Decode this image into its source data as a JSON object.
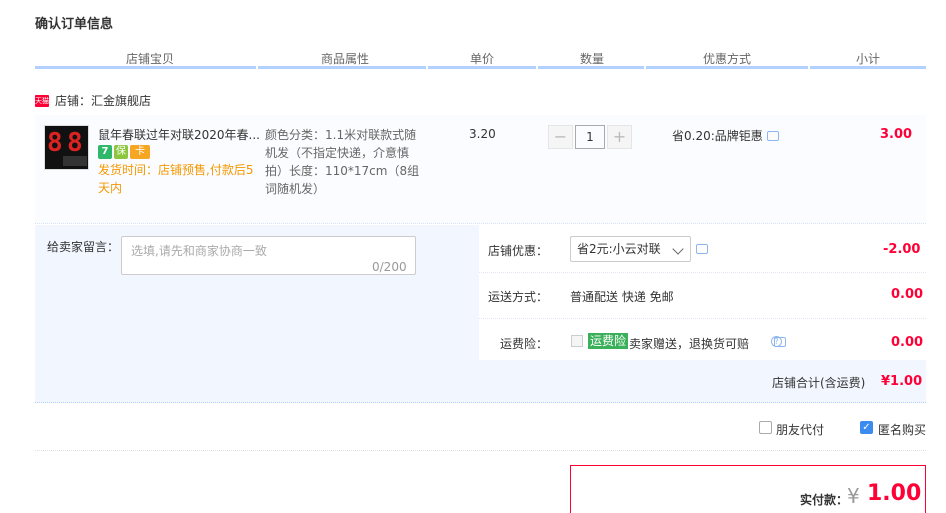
{
  "title": "确认订单信息",
  "columns": [
    "店铺宝贝",
    "商品属性",
    "单价",
    "数量",
    "优惠方式",
    "小计"
  ],
  "shop": {
    "badge": "天猫",
    "label": "店铺：汇金旗舰店"
  },
  "item": {
    "name": "鼠年春联过年对联2020年春...",
    "badges": [
      "7",
      "保",
      "卡"
    ],
    "ship_time": "发货时间：店铺预售,付款后5天内",
    "attributes": "颜色分类：1.1米对联款式随机发（不指定快递，介意慎拍）长度：110*17cm（8组词随机发）",
    "price": "3.20",
    "quantity": "1",
    "minus": "−",
    "plus": "+",
    "discount": "省0.20:品牌钜惠",
    "subtotal": "3.00"
  },
  "message": {
    "label": "给卖家留言：",
    "placeholder": "选填,请先和商家协商一致",
    "count": "0/200"
  },
  "shop_discount": {
    "label": "店铺优惠：",
    "selected": "省2元:小云对联",
    "amount": "-2.00"
  },
  "shipping": {
    "label": "运送方式：",
    "value": "普通配送 快递 免邮",
    "amount": "0.00"
  },
  "insurance": {
    "label": "运费险：",
    "tag": "运费险",
    "text": "卖家赠送，退换货可赔",
    "amount": "0.00"
  },
  "shop_total": {
    "label": "店铺合计(含运费)",
    "amount": "¥1.00"
  },
  "options": {
    "friend_pay": "朋友代付",
    "anonymous": "匿名购买"
  },
  "pay": {
    "label": "实付款：",
    "yen": "¥",
    "amount": "1.00"
  },
  "colors": {
    "accent": "#ff0036",
    "blue": "#3c8bf0",
    "tag_green": "#3bb05a"
  }
}
